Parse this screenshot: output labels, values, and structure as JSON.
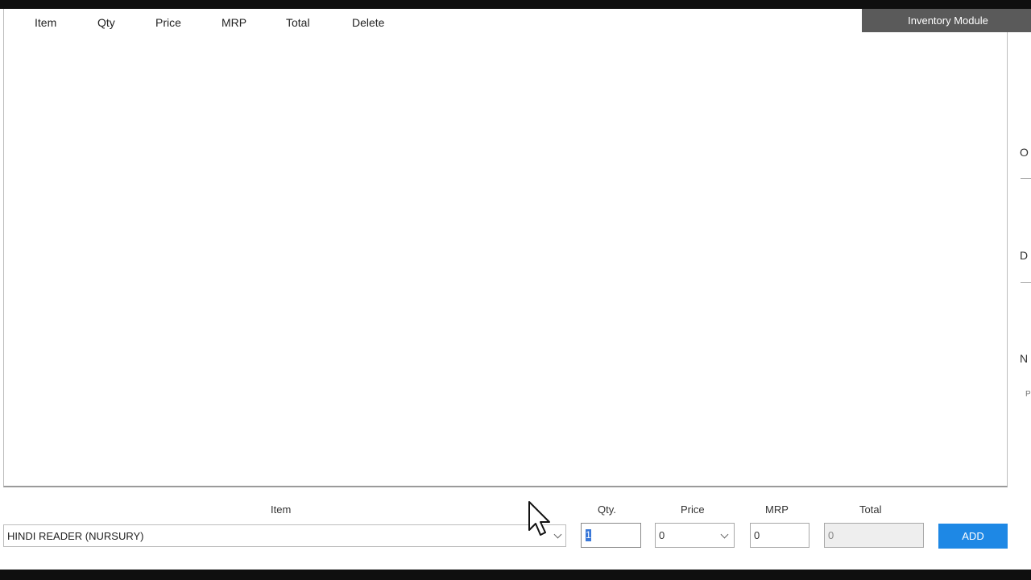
{
  "header": {
    "module_title": "Inventory Module"
  },
  "grid": {
    "columns": [
      "Item",
      "Qty",
      "Price",
      "MRP",
      "Total",
      "Delete"
    ],
    "rows": []
  },
  "right_panel": {
    "labels": [
      "O",
      "D",
      "N"
    ],
    "small_text": "P"
  },
  "entry": {
    "item": {
      "label": "Item",
      "value": "HINDI READER (NURSURY)"
    },
    "qty": {
      "label": "Qty.",
      "value": "1"
    },
    "price": {
      "label": "Price",
      "value": "0"
    },
    "mrp": {
      "label": "MRP",
      "value": "0"
    },
    "total": {
      "label": "Total",
      "value": "0"
    },
    "add_button": "ADD"
  },
  "colors": {
    "accent": "#1e88e5",
    "module_badge_bg": "#5a5a5a",
    "selection": "#3a78d8"
  },
  "icons": {
    "dropdown": "chevron-down-icon",
    "pointer": "mouse-cursor-icon"
  }
}
